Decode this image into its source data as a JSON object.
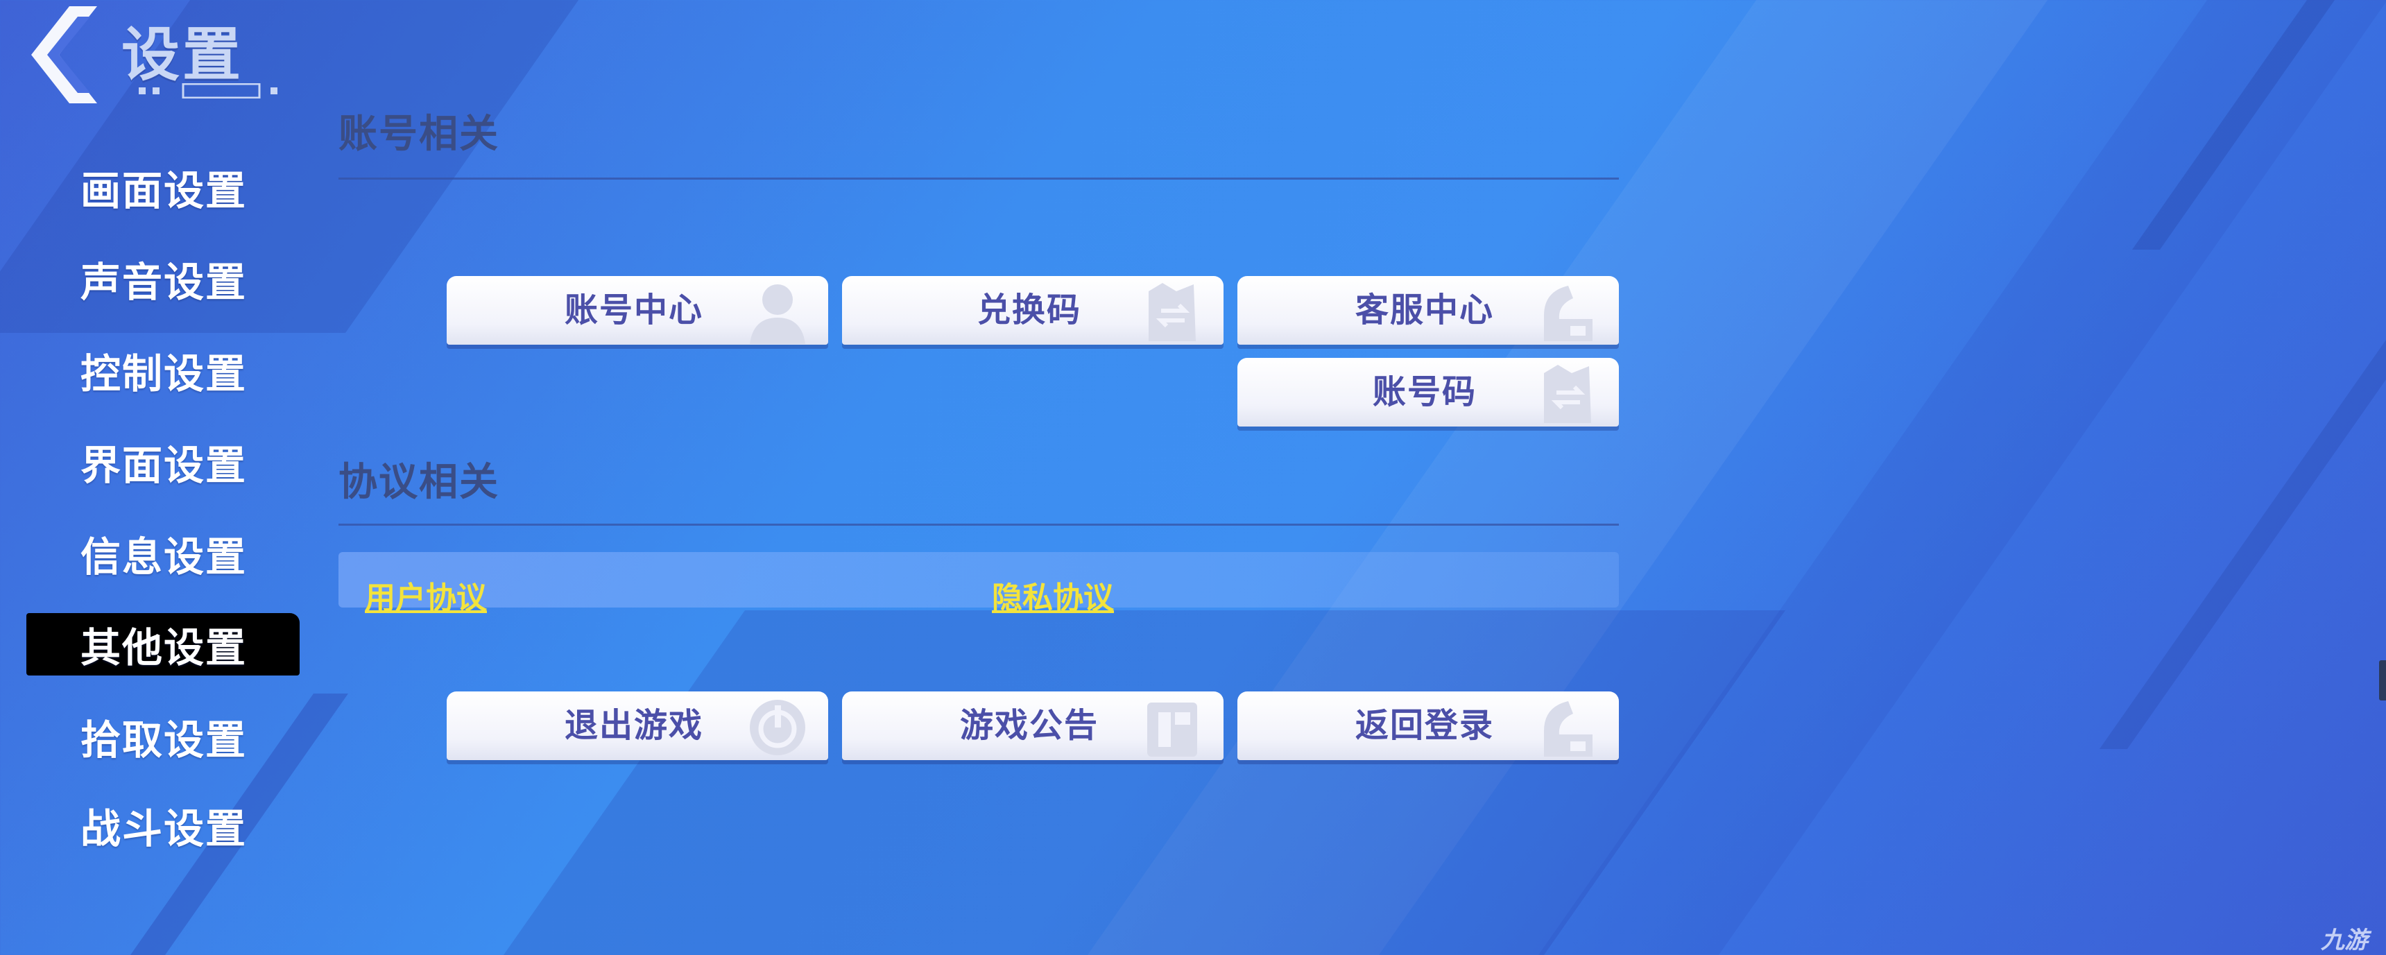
{
  "header": {
    "title": "设置",
    "back_icon": "chevron-left-icon"
  },
  "sidebar": {
    "items": [
      {
        "label": "画面设置",
        "active": false
      },
      {
        "label": "声音设置",
        "active": false
      },
      {
        "label": "控制设置",
        "active": false
      },
      {
        "label": "界面设置",
        "active": false
      },
      {
        "label": "信息设置",
        "active": false
      },
      {
        "label": "其他设置",
        "active": true
      },
      {
        "label": "拾取设置",
        "active": false
      },
      {
        "label": "战斗设置",
        "active": false
      }
    ]
  },
  "account_section": {
    "title": "账号相关",
    "buttons": [
      {
        "label": "账号中心",
        "icon": "user-icon"
      },
      {
        "label": "兑换码",
        "icon": "exchange-icon"
      },
      {
        "label": "客服中心",
        "icon": "support-icon"
      },
      {
        "label": "账号码",
        "icon": "exchange-icon"
      }
    ]
  },
  "protocol_section": {
    "title": "协议相关",
    "links": [
      {
        "label": "用户协议"
      },
      {
        "label": "隐私协议"
      }
    ]
  },
  "bottom_buttons": [
    {
      "label": "退出游戏",
      "icon": "power-icon"
    },
    {
      "label": "游戏公告",
      "icon": "notice-icon"
    },
    {
      "label": "返回登录",
      "icon": "return-icon"
    }
  ],
  "watermark": {
    "text": "九游"
  },
  "colors": {
    "link": "#f3e33c",
    "button_text": "#4b4fa8",
    "active_tab": "#000000"
  }
}
